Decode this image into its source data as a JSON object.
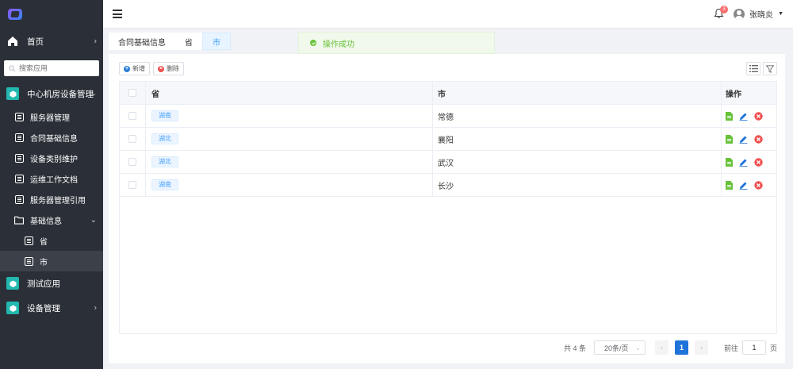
{
  "sidebar": {
    "home_label": "首页",
    "search_placeholder": "搜索应用",
    "group1_label": "中心机房设备管理",
    "sub_items": [
      "服务器管理",
      "合同基础信息",
      "设备类别维护",
      "运维工作文档",
      "服务器管理引用"
    ],
    "basic_info_label": "基础信息",
    "basic_children": [
      "省",
      "市"
    ],
    "test_app_label": "测试应用",
    "device_mgmt_label": "设备管理"
  },
  "header": {
    "notification_count": "3",
    "username": "张晓炎"
  },
  "tabs": [
    "合同基础信息",
    "省",
    "市"
  ],
  "toast": {
    "message": "操作成功"
  },
  "toolbar": {
    "add_label": "新增",
    "delete_label": "删除"
  },
  "table": {
    "columns": [
      "省",
      "市",
      "操作"
    ],
    "rows": [
      {
        "province": "湖南",
        "city": "常德"
      },
      {
        "province": "湖北",
        "city": "襄阳"
      },
      {
        "province": "湖北",
        "city": "武汉"
      },
      {
        "province": "湖南",
        "city": "长沙"
      }
    ]
  },
  "pagination": {
    "total_text": "共 4 条",
    "page_size": "20条/页",
    "current_page": "1",
    "goto_label": "前往",
    "goto_value": "1",
    "page_suffix": "页"
  },
  "colors": {
    "sidebar_bg": "#2b3038",
    "accent": "#409eff",
    "teal": "#22b8b0",
    "success": "#67c23a",
    "danger": "#f0504f"
  }
}
